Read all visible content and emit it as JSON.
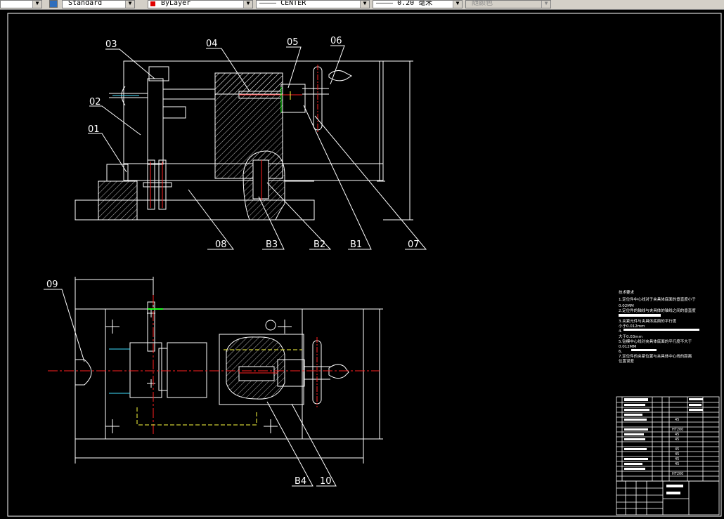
{
  "toolbar": {
    "textstyle": "Standard",
    "layer": "ByLayer",
    "linetype": "———— CENTER",
    "lineweight": "———— 0.20 毫米",
    "plotstyle": "随颜色",
    "icon": "text-style-icon",
    "layer_color": "#e00000",
    "arrow": "▼"
  },
  "drawing": {
    "labels": {
      "p01": "01",
      "p02": "02",
      "p03": "03",
      "p04": "04",
      "p05": "05",
      "p06": "06",
      "p07": "07",
      "p08": "08",
      "p09": "09",
      "p10": "10",
      "b1": "B1",
      "b2": "B2",
      "b3": "B3",
      "b4": "B4"
    },
    "colors": {
      "line": "#ffffff",
      "red": "#ff2020",
      "green": "#20ff20",
      "yellow": "#ffff40",
      "cyan": "#40e0ff"
    }
  },
  "notes": {
    "title": "技术要求",
    "items": [
      "1.定位件中心线对于夹具体底面的垂直度小于",
      "0.02MM",
      "2.定位件的轴线与夹具体的轴线之间的垂直度",
      "3.夹紧元件与夹具体底面的平行度",
      "小于0.012mm",
      "4.",
      "大于0.03mm",
      "5.钻模中心线对夹具体底面的平行度不大于",
      "0.012MM",
      "6.",
      "7.定位件的夹紧位置与夹具体中心线的距离",
      "位置误差"
    ]
  },
  "bom": {
    "materials": [
      "45",
      "HT200",
      "45",
      "45",
      "45",
      "45",
      "45",
      "45",
      "HT200"
    ]
  }
}
